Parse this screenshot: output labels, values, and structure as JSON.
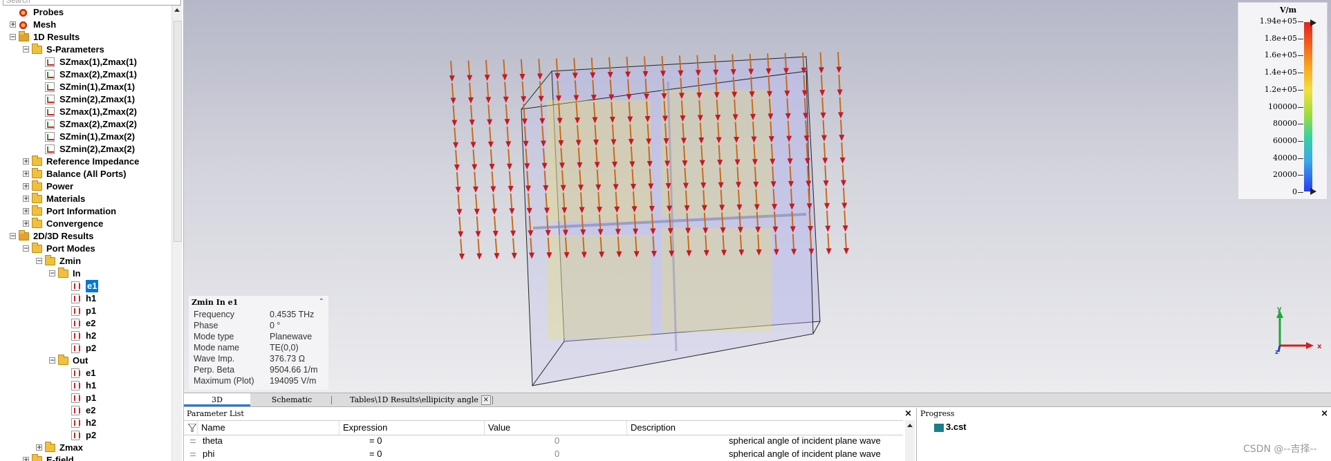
{
  "search": {
    "placeholder": "Search"
  },
  "tree": {
    "items": [
      {
        "label": "Probes",
        "icon": "gear-icon"
      },
      {
        "label": "Mesh",
        "icon": "gear-icon"
      },
      {
        "label": "1D Results",
        "icon": "results-folder-icon"
      },
      {
        "label": "S-Parameters",
        "icon": "folder-icon"
      },
      {
        "label": "SZmax(1),Zmax(1)",
        "icon": "sparam-icon"
      },
      {
        "label": "SZmax(2),Zmax(1)",
        "icon": "sparam-icon"
      },
      {
        "label": "SZmin(1),Zmax(1)",
        "icon": "sparam-icon"
      },
      {
        "label": "SZmin(2),Zmax(1)",
        "icon": "sparam-icon"
      },
      {
        "label": "SZmax(1),Zmax(2)",
        "icon": "sparam-icon"
      },
      {
        "label": "SZmax(2),Zmax(2)",
        "icon": "sparam-icon"
      },
      {
        "label": "SZmin(1),Zmax(2)",
        "icon": "sparam-icon"
      },
      {
        "label": "SZmin(2),Zmax(2)",
        "icon": "sparam-icon"
      },
      {
        "label": "Reference Impedance",
        "icon": "folder-icon"
      },
      {
        "label": "Balance (All Ports)",
        "icon": "folder-icon"
      },
      {
        "label": "Power",
        "icon": "folder-icon"
      },
      {
        "label": "Materials",
        "icon": "folder-icon"
      },
      {
        "label": "Port Information",
        "icon": "folder-icon"
      },
      {
        "label": "Convergence",
        "icon": "folder-icon"
      },
      {
        "label": "2D/3D Results",
        "icon": "results-folder-icon"
      },
      {
        "label": "Port Modes",
        "icon": "folder-icon"
      },
      {
        "label": "Zmin",
        "icon": "folder-icon"
      },
      {
        "label": "In",
        "icon": "folder-icon"
      },
      {
        "label": "e1",
        "icon": "mode-icon"
      },
      {
        "label": "h1",
        "icon": "mode-icon"
      },
      {
        "label": "p1",
        "icon": "mode-icon"
      },
      {
        "label": "e2",
        "icon": "mode-icon"
      },
      {
        "label": "h2",
        "icon": "mode-icon"
      },
      {
        "label": "p2",
        "icon": "mode-icon"
      },
      {
        "label": "Out",
        "icon": "folder-icon"
      },
      {
        "label": "e1",
        "icon": "mode-icon"
      },
      {
        "label": "h1",
        "icon": "mode-icon"
      },
      {
        "label": "p1",
        "icon": "mode-icon"
      },
      {
        "label": "e2",
        "icon": "mode-icon"
      },
      {
        "label": "h2",
        "icon": "mode-icon"
      },
      {
        "label": "p2",
        "icon": "mode-icon"
      },
      {
        "label": "Zmax",
        "icon": "folder-icon"
      },
      {
        "label": "E-field",
        "icon": "folder-icon"
      }
    ],
    "selected_label": "e1"
  },
  "legend": {
    "unit": "V/m",
    "ticks": [
      "1.94e+05",
      "1.8e+05",
      "1.6e+05",
      "1.4e+05",
      "1.2e+05",
      "100000",
      "80000",
      "60000",
      "40000",
      "20000",
      "0"
    ]
  },
  "info": {
    "title": "Zmin In e1",
    "rows": [
      {
        "label": "Frequency",
        "value": "0.4535 THz"
      },
      {
        "label": "Phase",
        "value": "0 °"
      },
      {
        "label": "Mode type",
        "value": "Planewave"
      },
      {
        "label": "Mode name",
        "value": "TE(0,0)"
      },
      {
        "label": "Wave Imp.",
        "value": "376.73 Ω"
      },
      {
        "label": "Perp. Beta",
        "value": "9504.66 1/m"
      },
      {
        "label": "Maximum (Plot)",
        "value": "194095 V/m"
      }
    ]
  },
  "axes": {
    "y": "y",
    "x": "x",
    "z": "z"
  },
  "tabs": [
    {
      "label": "3D"
    },
    {
      "label": "Schematic"
    },
    {
      "label": "Tables\\1D Results\\ellipicity angle"
    }
  ],
  "params": {
    "title": "Parameter List",
    "columns": [
      "Name",
      "Expression",
      "Value",
      "Description"
    ],
    "rows": [
      {
        "name": "theta",
        "expr": "= 0",
        "value": "0",
        "desc": "spherical angle of incident plane wave"
      },
      {
        "name": "phi",
        "expr": "= 0",
        "value": "0",
        "desc": "spherical angle of incident plane wave"
      }
    ]
  },
  "progress": {
    "title": "Progress",
    "file": "3.cst"
  },
  "watermark": "CSDN @--吉择--",
  "colors": {
    "arrow_head": "#c3192a",
    "arrow_shaft": "#c96a18",
    "selection": "#0078d7"
  }
}
